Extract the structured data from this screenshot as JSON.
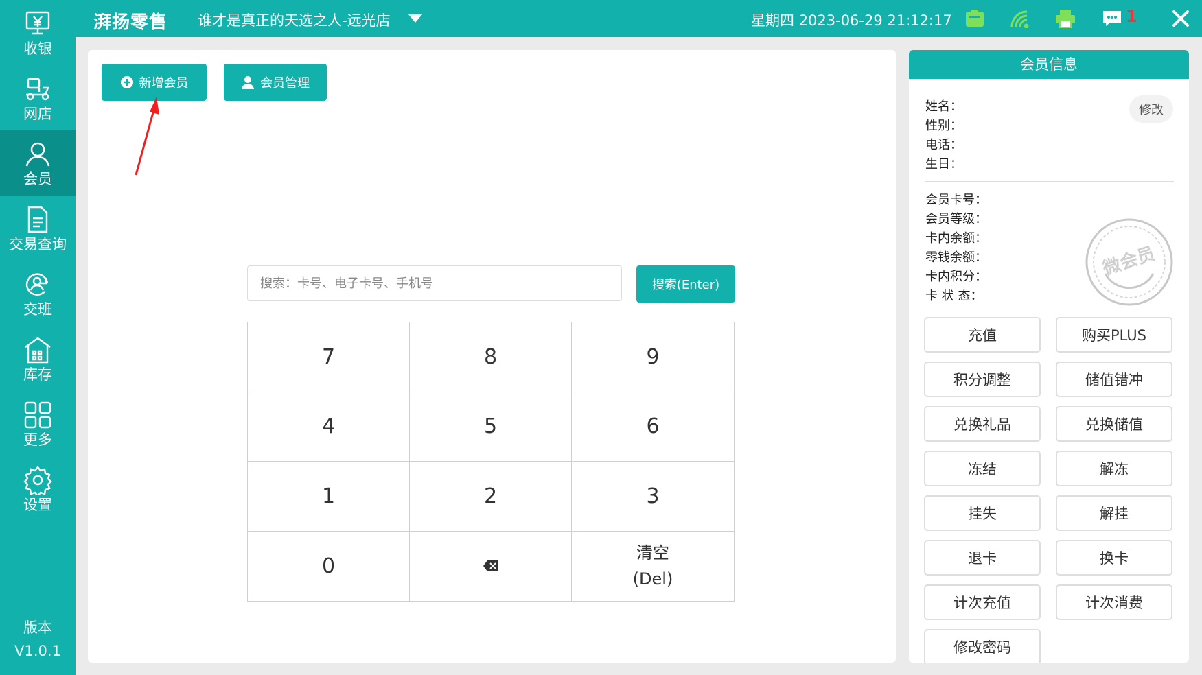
{
  "sidebar": {
    "items": [
      {
        "label": "收银",
        "icon": "cashier-icon"
      },
      {
        "label": "网店",
        "icon": "delivery-scooter-icon"
      },
      {
        "label": "会员",
        "icon": "member-icon",
        "active": true
      },
      {
        "label": "交易查询",
        "icon": "document-icon"
      },
      {
        "label": "交班",
        "icon": "shift-handover-icon"
      },
      {
        "label": "库存",
        "icon": "warehouse-icon"
      },
      {
        "label": "更多",
        "icon": "grid-icon"
      },
      {
        "label": "设置",
        "icon": "gear-icon"
      }
    ],
    "version_label": "版本",
    "version_value": "V1.0.1"
  },
  "topbar": {
    "brand": "湃扬零售",
    "store": "谁才是真正的天选之人-远光店",
    "datetime": "星期四 2023-06-29 21:12:17",
    "message_count": "1",
    "icons": [
      "cash-drawer-icon",
      "wifi-icon",
      "printer-icon",
      "message-icon",
      "close-icon"
    ]
  },
  "main": {
    "add_member_label": "新增会员",
    "member_manage_label": "会员管理",
    "search_placeholder": "搜索：卡号、电子卡号、手机号",
    "search_value": "",
    "search_button": "搜索(Enter)",
    "keypad": [
      {
        "label": "7"
      },
      {
        "label": "8"
      },
      {
        "label": "9"
      },
      {
        "label": "4"
      },
      {
        "label": "5"
      },
      {
        "label": "6"
      },
      {
        "label": "1"
      },
      {
        "label": "2"
      },
      {
        "label": "3"
      },
      {
        "label": "0"
      },
      {
        "label": "",
        "icon": "backspace-icon"
      },
      {
        "label": "清空",
        "sub": "(Del)"
      }
    ]
  },
  "member_panel": {
    "title": "会员信息",
    "edit_label": "修改",
    "basic_fields": [
      "姓名：",
      "性别：",
      "电话：",
      "生日："
    ],
    "card_fields": [
      "会员卡号：",
      "会员等级：",
      "卡内余额：",
      "零钱余额：",
      "卡内积分：",
      "卡 状 态："
    ],
    "stamp_text": "微会员",
    "actions": [
      "充值",
      "购买PLUS",
      "积分调整",
      "储值错冲",
      "兑换礼品",
      "兑换储值",
      "冻结",
      "解冻",
      "挂失",
      "解挂",
      "退卡",
      "换卡",
      "计次充值",
      "计次消费",
      "修改密码"
    ]
  },
  "colors": {
    "accent": "#13b1ab",
    "accent_dark": "#0a8f8a",
    "alert": "#ff3030"
  }
}
